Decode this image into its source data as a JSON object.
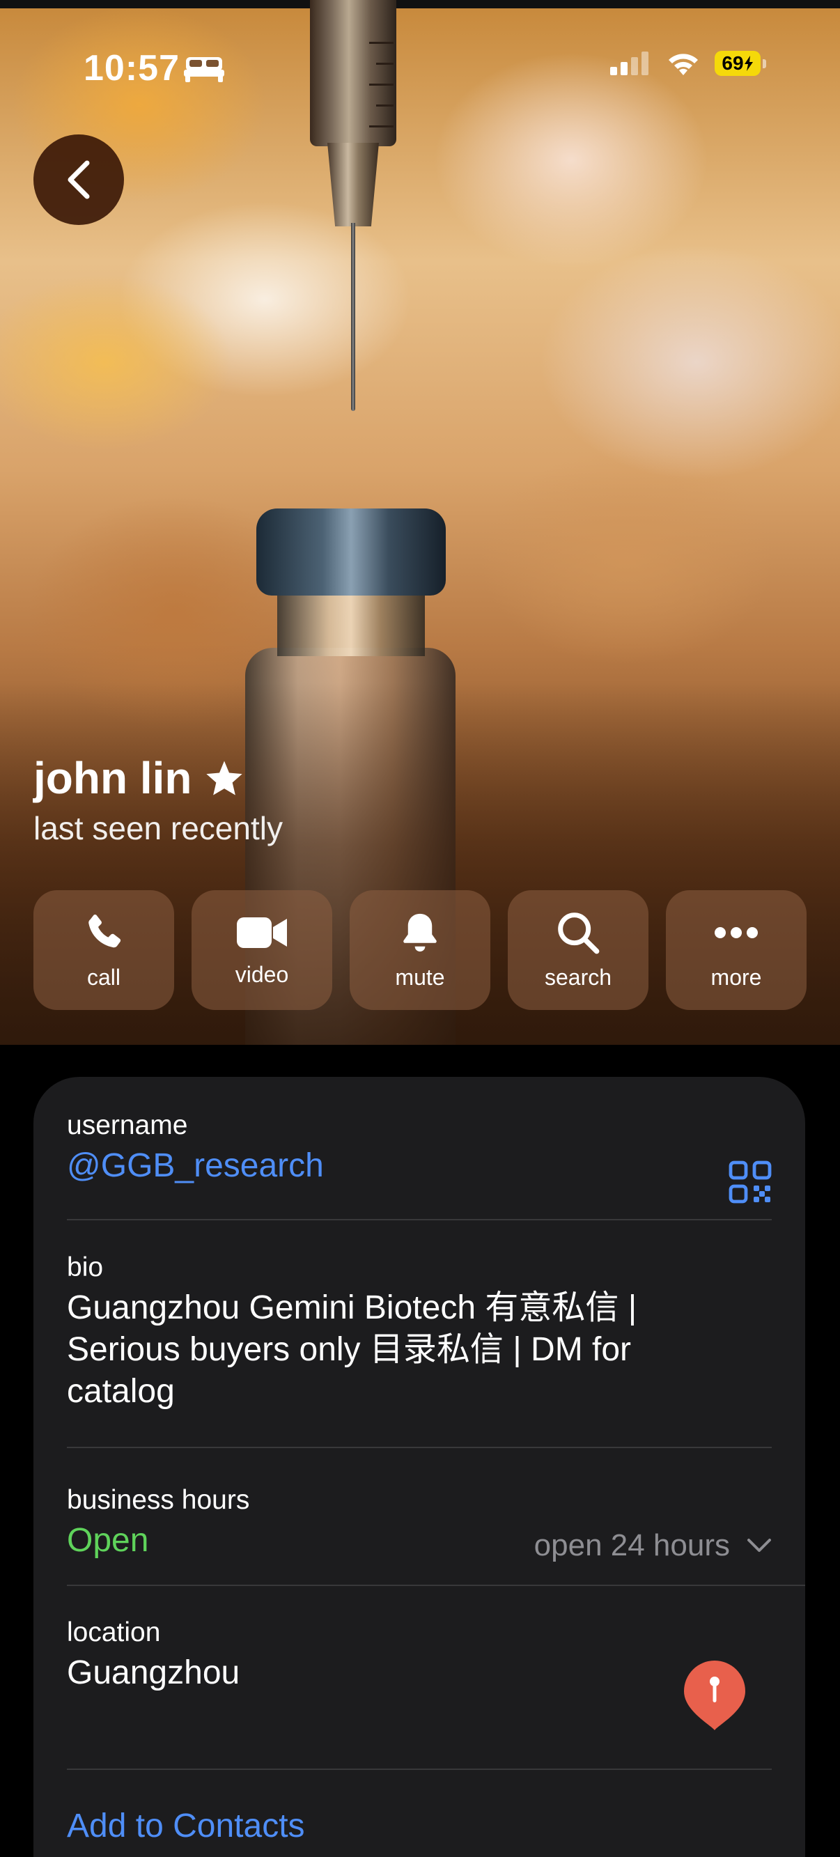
{
  "status_bar": {
    "time": "10:57",
    "battery": "69"
  },
  "profile": {
    "name": "john lin",
    "status": "last seen recently"
  },
  "actions": [
    {
      "label": "call",
      "icon": "phone-icon"
    },
    {
      "label": "video",
      "icon": "video-icon"
    },
    {
      "label": "mute",
      "icon": "bell-icon"
    },
    {
      "label": "search",
      "icon": "search-icon"
    },
    {
      "label": "more",
      "icon": "more-icon"
    }
  ],
  "info": {
    "username_label": "username",
    "username_value": "@GGB_research",
    "bio_label": "bio",
    "bio_value": "Guangzhou Gemini Biotech 有意私信 | Serious buyers only 目录私信 | DM for catalog",
    "hours_label": "business hours",
    "hours_status": "Open",
    "hours_detail": "open 24 hours",
    "location_label": "location",
    "location_value": "Guangzhou",
    "add_contact": "Add to Contacts"
  },
  "colors": {
    "link": "#4f8ef7",
    "open": "#5fd35b",
    "pin": "#e8604c",
    "battery": "#f5d90a"
  }
}
